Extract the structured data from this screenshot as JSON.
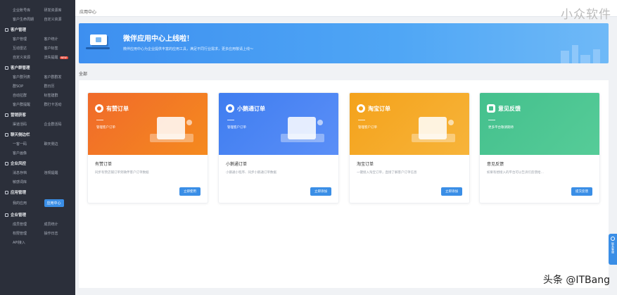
{
  "header": {
    "breadcrumb": "应用中心",
    "watermark": "小众软件"
  },
  "sidebar": {
    "top_items": [
      "企业账号库",
      "研发资源库",
      "客户生命周期",
      "自定义资源"
    ],
    "groups": [
      {
        "title": "客户管理",
        "items": [
          "客户管理",
          "客户统计",
          "互动雷达",
          "客户标签",
          "自定义资源",
          "流失提醒"
        ],
        "badge_index": 5,
        "badge": "NEW"
      },
      {
        "title": "客户群管理",
        "items": [
          "客户群列表",
          "客户群群发",
          "群SOP",
          "群日历",
          "自动拉群",
          "标签建群",
          "客户群提醒",
          "群打卡活动"
        ]
      },
      {
        "title": "营销获客",
        "items": [
          "渠道活码",
          "企业群活码"
        ]
      },
      {
        "title": "聊天侧边栏",
        "items": [
          "一客一码",
          "聊天侧边",
          "客户画像"
        ]
      },
      {
        "title": "企业风控",
        "items": [
          "消息存档",
          "违规提醒",
          "敏感词库"
        ]
      },
      {
        "title": "应用管理",
        "items": [
          "我的应用",
          "应用中心"
        ],
        "active_index": 1
      },
      {
        "title": "企业管理",
        "items": [
          "成员管理",
          "成员统计",
          "权限管理",
          "操作日志",
          "API接入"
        ]
      }
    ]
  },
  "banner": {
    "title": "微伴应用中心上线啦！",
    "subtitle": "微伴应用中心为企业提供丰富的应用工具，满足不同行业需求，更多应用敬请上线～"
  },
  "section_label": "全部",
  "cards": [
    {
      "hero_title": "有赞订单",
      "hero_sub": "管理客户订单",
      "title": "有赞订单",
      "desc": "同步有赞店铺订单到微伴客户订单数据",
      "button": "立即使用"
    },
    {
      "hero_title": "小鹅通订单",
      "hero_sub": "管理客户订单",
      "title": "小鹅通订单",
      "desc": "小鹅通小程序、同步小鹅通订单数据",
      "button": "立即添加"
    },
    {
      "hero_title": "淘宝订单",
      "hero_sub": "管理客户订单",
      "title": "淘宝订单",
      "desc": "一键接入淘宝订单，直接了解客户订单信息",
      "button": "立即添加"
    },
    {
      "hero_title": "意见反馈",
      "hero_sub": "更多平台敬请期待",
      "title": "意见反馈",
      "desc": "如果有想接入的平台可以告诉们反馈给…",
      "button": "提交反馈"
    }
  ],
  "float_help": "联系客服",
  "watermark_bottom": "头条 @ITBang"
}
